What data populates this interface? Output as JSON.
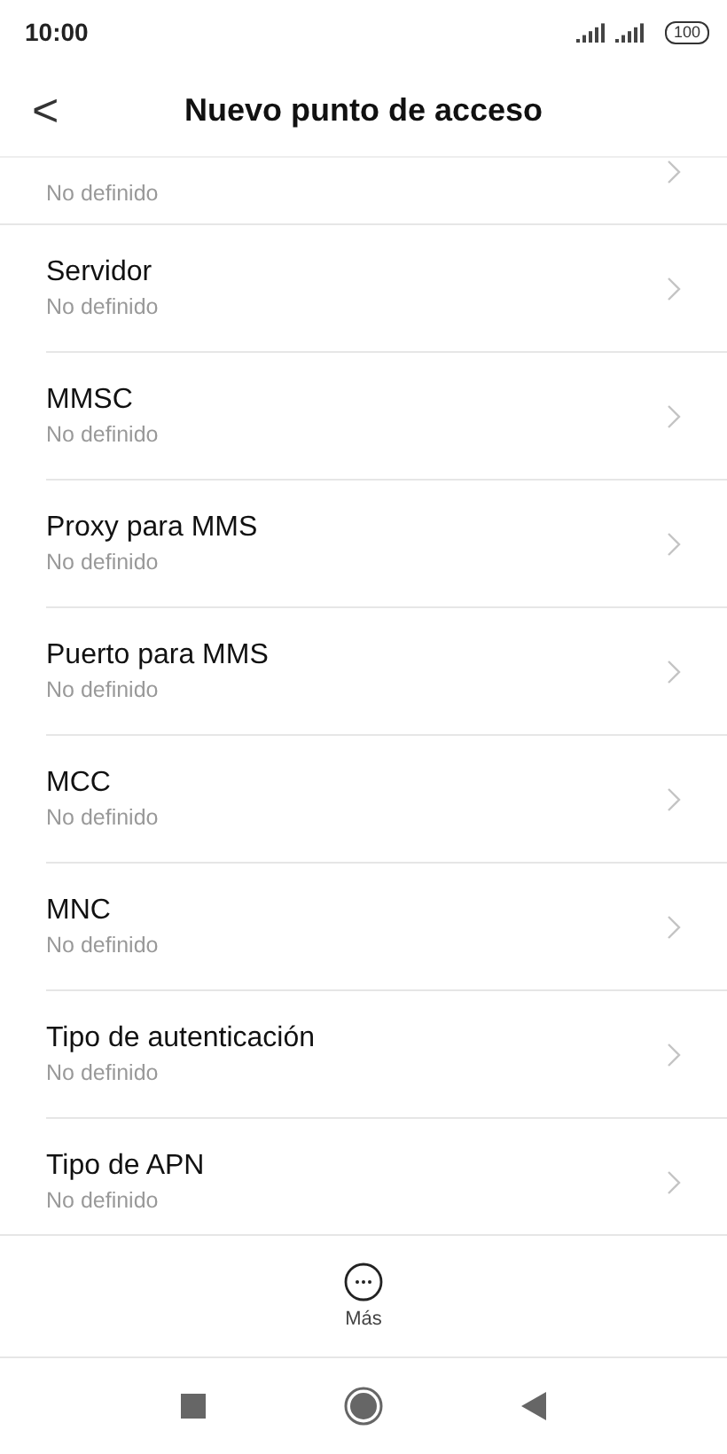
{
  "status_bar": {
    "time": "10:00",
    "battery": "100"
  },
  "header": {
    "back": "<",
    "title": "Nuevo punto de acceso"
  },
  "partial_item": {
    "subtitle": "No definido"
  },
  "items": [
    {
      "title": "Servidor",
      "subtitle": "No definido"
    },
    {
      "title": "MMSC",
      "subtitle": "No definido"
    },
    {
      "title": "Proxy para MMS",
      "subtitle": "No definido"
    },
    {
      "title": "Puerto para MMS",
      "subtitle": "No definido"
    },
    {
      "title": "MCC",
      "subtitle": "No definido"
    },
    {
      "title": "MNC",
      "subtitle": "No definido"
    },
    {
      "title": "Tipo de autenticación",
      "subtitle": "No definido"
    },
    {
      "title": "Tipo de APN",
      "subtitle": "No definido"
    }
  ],
  "more_button": {
    "label": "Más"
  }
}
